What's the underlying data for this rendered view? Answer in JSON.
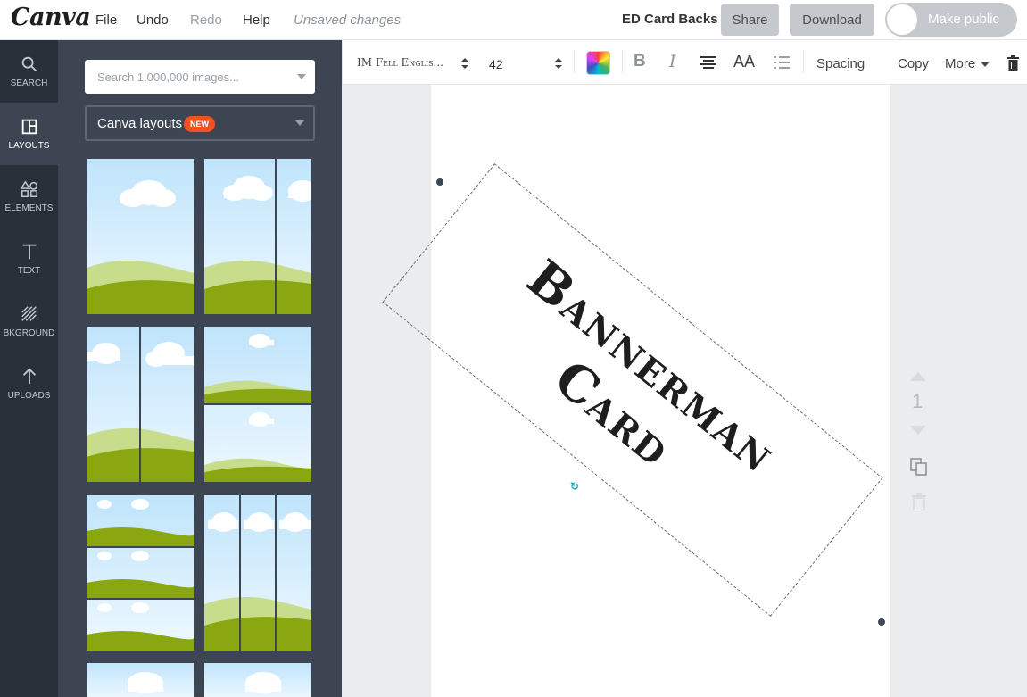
{
  "topbar": {
    "logo": "Canva",
    "menu": [
      "File",
      "Undo",
      "Redo",
      "Help"
    ],
    "unsaved": "Unsaved changes",
    "doc_title": "ED Card Backs",
    "share": "Share",
    "download": "Download",
    "make_public": "Make public"
  },
  "rail": [
    {
      "label": "SEARCH",
      "icon": "search-icon"
    },
    {
      "label": "LAYOUTS",
      "icon": "layouts-icon"
    },
    {
      "label": "ELEMENTS",
      "icon": "elements-icon"
    },
    {
      "label": "TEXT",
      "icon": "text-icon"
    },
    {
      "label": "BKGROUND",
      "icon": "background-icon"
    },
    {
      "label": "UPLOADS",
      "icon": "upload-icon"
    }
  ],
  "panel": {
    "search_placeholder": "Search 1,000,000 images...",
    "layouts_label": "Canva layouts",
    "new_badge": "NEW"
  },
  "toolbar": {
    "font": "IM Fell Englis...",
    "size": "42",
    "spacing": "Spacing",
    "copy": "Copy",
    "more": "More"
  },
  "canvas": {
    "line1": "Bannerman",
    "line2": "Card",
    "page_number": "1"
  },
  "colors": {
    "rail_bg": "#293039",
    "panel_bg": "#3d4452",
    "accent_badge": "#f4511e",
    "rotate_handle": "#17b6c8"
  }
}
